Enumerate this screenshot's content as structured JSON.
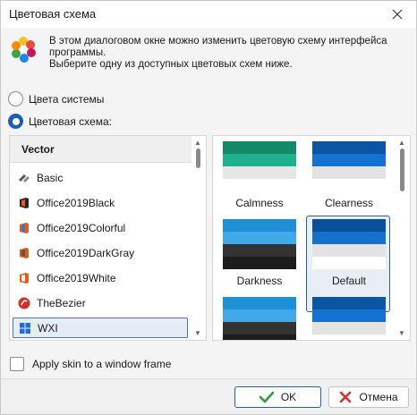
{
  "window": {
    "title": "Цветовая схема"
  },
  "info": {
    "line1": "В этом диалоговом окне можно изменить цветовую схему интерфейса",
    "line2": "программы.",
    "line3": "Выберите одну из доступных цветовых схем ниже."
  },
  "radios": {
    "system": {
      "label": "Цвета системы",
      "checked": false
    },
    "scheme": {
      "label": "Цветовая схема:",
      "checked": true
    }
  },
  "skins": {
    "header": "Vector",
    "items": [
      {
        "label": "Basic",
        "icon": "basic-skin-icon"
      },
      {
        "label": "Office2019Black",
        "icon": "office-icon"
      },
      {
        "label": "Office2019Colorful",
        "icon": "office-icon"
      },
      {
        "label": "Office2019DarkGray",
        "icon": "office-icon"
      },
      {
        "label": "Office2019White",
        "icon": "office-icon"
      },
      {
        "label": "TheBezier",
        "icon": "bezier-icon"
      },
      {
        "label": "WXI",
        "icon": "windows-icon",
        "selected": true
      }
    ]
  },
  "palettes": {
    "items": [
      {
        "label": "Calmness",
        "colors": [
          "#13896a",
          "#1fb08d",
          "#e6e6e6",
          "#ffffff"
        ]
      },
      {
        "label": "Clearness",
        "colors": [
          "#0b55a3",
          "#1472d0",
          "#e3e3e3",
          "#ffffff"
        ]
      },
      {
        "label": "Darkness",
        "colors": [
          "#1f8fd6",
          "#41a9e8",
          "#333333",
          "#1c1c1c"
        ]
      },
      {
        "label": "Default",
        "colors": [
          "#0a4f9a",
          "#1670cc",
          "#e3e3e3",
          "#ffffff"
        ],
        "selected": true
      },
      {
        "label": "",
        "colors": [
          "#1f8fd6",
          "#41a9e8",
          "#333333",
          "#1c1c1c"
        ]
      },
      {
        "label": "",
        "colors": [
          "#0b55a3",
          "#1472d0",
          "#e3e3e3",
          "#ffffff"
        ]
      }
    ]
  },
  "frame_option": {
    "label": "Apply skin to a window frame",
    "checked": false
  },
  "buttons": {
    "ok": "OK",
    "cancel": "Отмена"
  },
  "colors": {
    "accent": "#1a5fb4",
    "ok_check": "#2e9e3a",
    "cancel_x": "#d13438"
  }
}
